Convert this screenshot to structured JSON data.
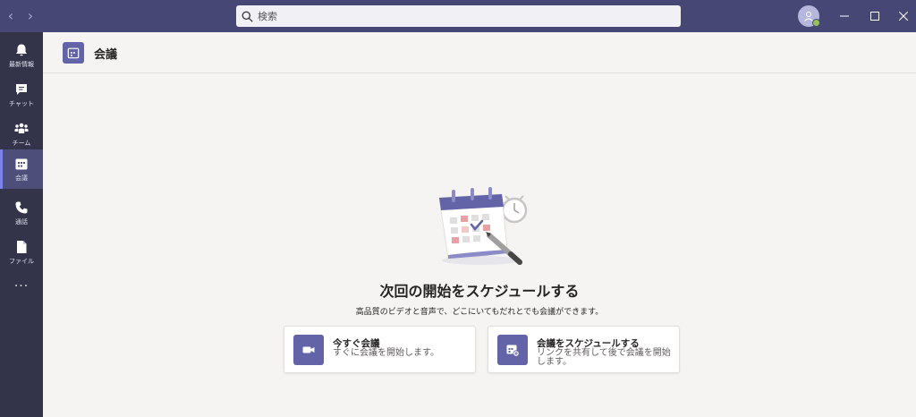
{
  "titlebar": {
    "search": {
      "placeholder": "検索"
    },
    "colors": {
      "bar": "#464775",
      "status": "#92c353"
    }
  },
  "rail": {
    "items": [
      {
        "label": "最新情報",
        "icon": "bell-icon"
      },
      {
        "label": "チャット",
        "icon": "chat-icon"
      },
      {
        "label": "チーム",
        "icon": "teams-icon"
      },
      {
        "label": "会議",
        "icon": "calendar-icon",
        "active": true
      },
      {
        "label": "通話",
        "icon": "phone-icon"
      },
      {
        "label": "ファイル",
        "icon": "file-icon"
      }
    ],
    "more": "..."
  },
  "header": {
    "title": "会議",
    "icon": "calendar-icon"
  },
  "main": {
    "title": "次回の開始をスケジュールする",
    "subtitle": "高品質のビデオと音声で、どこにいてもだれとでも会議ができます。",
    "cards": {
      "now": {
        "title": "今すぐ会議",
        "desc": "すぐに会議を開始します。",
        "icon": "video-camera-icon"
      },
      "schedule": {
        "title": "会議をスケジュールする",
        "desc": "リンクを共有して後で会議を開始します。",
        "icon": "calendar-add-icon"
      }
    }
  },
  "colors": {
    "accent": "#6264a7",
    "rail": "#33344a",
    "background": "#f5f4f2"
  }
}
